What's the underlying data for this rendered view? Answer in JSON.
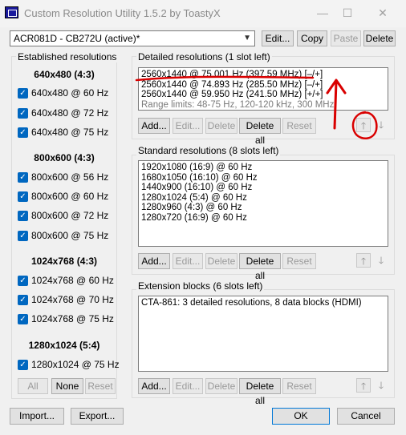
{
  "window": {
    "title": "Custom Resolution Utility 1.5.2 by ToastyX",
    "minimize": "—",
    "maximize": "☐",
    "close": "✕"
  },
  "toolbar": {
    "monitor": "ACR081D - CB272U (active)*",
    "edit": "Edit...",
    "copy": "Copy",
    "paste": "Paste",
    "delete": "Delete"
  },
  "established": {
    "title": "Established resolutions",
    "groups": [
      {
        "heading": "640x480 (4:3)",
        "items": [
          "640x480 @ 60 Hz",
          "640x480 @ 72 Hz",
          "640x480 @ 75 Hz"
        ]
      },
      {
        "heading": "800x600 (4:3)",
        "items": [
          "800x600 @ 56 Hz",
          "800x600 @ 60 Hz",
          "800x600 @ 72 Hz",
          "800x600 @ 75 Hz"
        ]
      },
      {
        "heading": "1024x768 (4:3)",
        "items": [
          "1024x768 @ 60 Hz",
          "1024x768 @ 70 Hz",
          "1024x768 @ 75 Hz"
        ]
      },
      {
        "heading": "1280x1024 (5:4)",
        "items": [
          "1280x1024 @ 75 Hz"
        ]
      }
    ],
    "all": "All",
    "none": "None",
    "reset": "Reset"
  },
  "detailed": {
    "title": "Detailed resolutions (1 slot left)",
    "items": [
      "2560x1440 @ 75.001 Hz (397.59 MHz) [–/+]",
      "2560x1440 @ 74.893 Hz (285.50 MHz) [–/+]",
      "2560x1440 @ 59.950 Hz (241.50 MHz) [+/+]"
    ],
    "limits": "Range limits: 48-75 Hz, 120-120 kHz, 300 MHz"
  },
  "standard": {
    "title": "Standard resolutions (8 slots left)",
    "items": [
      "1920x1080 (16:9) @ 60 Hz",
      "1680x1050 (16:10) @ 60 Hz",
      "1440x900 (16:10) @ 60 Hz",
      "1280x1024 (5:4) @ 60 Hz",
      "1280x960 (4:3) @ 60 Hz",
      "1280x720 (16:9) @ 60 Hz"
    ]
  },
  "extension": {
    "title": "Extension blocks (6 slots left)",
    "items": [
      "CTA-861: 3 detailed resolutions, 8 data blocks (HDMI)"
    ]
  },
  "section_buttons": {
    "add": "Add...",
    "edit": "Edit...",
    "delete": "Delete",
    "delete_all": "Delete all",
    "reset": "Reset",
    "up": "🡑",
    "down": "🡓"
  },
  "bottom": {
    "import": "Import...",
    "export": "Export...",
    "ok": "OK",
    "cancel": "Cancel"
  },
  "annotation_color": "#d90000"
}
